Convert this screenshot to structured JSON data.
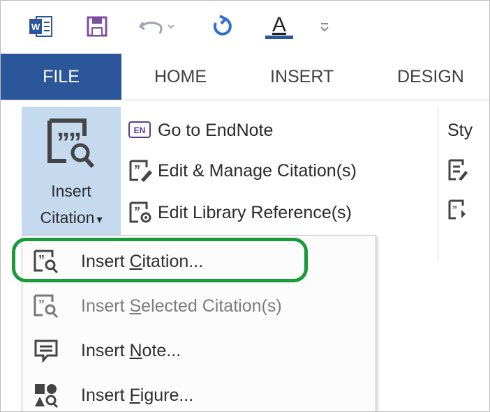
{
  "quick_access": {
    "icons": [
      "word-logo-icon",
      "save-icon",
      "undo-icon",
      "redo-icon",
      "font-color-icon",
      "customize-qat-icon"
    ],
    "font_color_glyph": "A",
    "colors": {
      "word_blue": "#2b579a",
      "save_purple": "#7b4fa0",
      "undo_gray": "#9aa6b6",
      "redo_blue": "#2e6fd1"
    }
  },
  "tabs": [
    "FILE",
    "HOME",
    "INSERT",
    "DESIGN"
  ],
  "ribbon": {
    "insert_citation": {
      "line1": "Insert",
      "line2": "Citation",
      "arrow": "▾"
    },
    "commands": [
      {
        "label": "Go to EndNote",
        "icon": "endnote-icon",
        "badge": "EN"
      },
      {
        "label": "Edit & Manage Citation(s)",
        "icon": "edit-citation-icon"
      },
      {
        "label": "Edit Library Reference(s)",
        "icon": "edit-library-icon"
      }
    ],
    "style_partial": "Sty"
  },
  "dropdown": {
    "items": [
      {
        "pre": "Insert ",
        "accel": "C",
        "post": "itation...",
        "icon": "insert-citation-icon",
        "highlighted": true
      },
      {
        "pre": "Insert ",
        "accel": "S",
        "post": "elected Citation(s)",
        "icon": "insert-selected-citation-icon",
        "disabled": true
      },
      {
        "pre": "Insert ",
        "accel": "N",
        "post": "ote...",
        "icon": "insert-note-icon"
      },
      {
        "pre": "Insert ",
        "accel": "F",
        "post": "igure...",
        "icon": "insert-figure-icon"
      }
    ]
  },
  "accent": {
    "highlight_green": "#1a9b3a",
    "selection_blue": "#c5d9ef"
  }
}
